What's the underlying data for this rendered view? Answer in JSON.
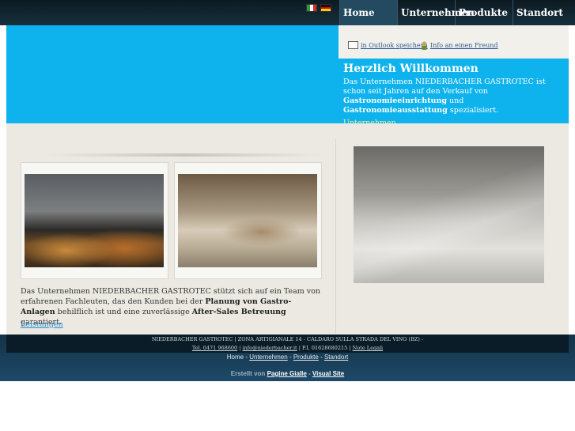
{
  "nav": {
    "items": [
      "Home",
      "Unternehmen",
      "Produkte",
      "Standort"
    ],
    "active": "Home"
  },
  "flags": {
    "italian": "italian-flag",
    "german": "german-flag"
  },
  "toolbar": {
    "outlook_label": "in Outlook speichern",
    "friend_label": "Info an einen Freund"
  },
  "welcome": {
    "title": "Herzlich Willkommen",
    "text_part1": "Das Unternehmen NIEDERBACHER GASTROTEC ist schon seit Jahren auf den Verkauf von ",
    "text_bold1": "Gastronomieeinrichtung",
    "text_part2": " und ",
    "text_bold2": "Gastronomieausstattung",
    "text_part3": " spezialisiert.",
    "link": "Unternehmen"
  },
  "content": {
    "desc_part1": "Das Unternehmen NIEDERBACHER GASTROTEC stützt sich auf ein Team von erfahrenen Fachleuten, das den Kunden bei der ",
    "desc_bold1": "Planung von Gastro-Anlagen",
    "desc_part2": " behilflich ist und eine zuverlässige ",
    "desc_bold2": "After-Sales Betreuung",
    "desc_part3": " garantiert.",
    "link": "Leistungen"
  },
  "footer": {
    "line1": "NIEDERBACHER GASTROTEC | ZONA ARTIGIANALE 14 - CALDARO SULLA STRADA DEL VINO (BZ) -",
    "phone": "Tel. 0471 968600",
    "email": "info@niederbacher.it",
    "vat": "P.I. 01628680215",
    "legal": "Note Legali"
  },
  "bottom_nav": {
    "home": "Home",
    "unternehmen": "Unternehmen",
    "produkte": "Produkte",
    "standort": "Standort"
  },
  "credit": {
    "prefix": "Erstellt von",
    "link1": "Pagine Gialle",
    "link2": "Visual Site"
  },
  "colors": {
    "hero": "#0eb3ee",
    "content_bg": "#ebe9e1",
    "footer": "#0a1c27"
  }
}
